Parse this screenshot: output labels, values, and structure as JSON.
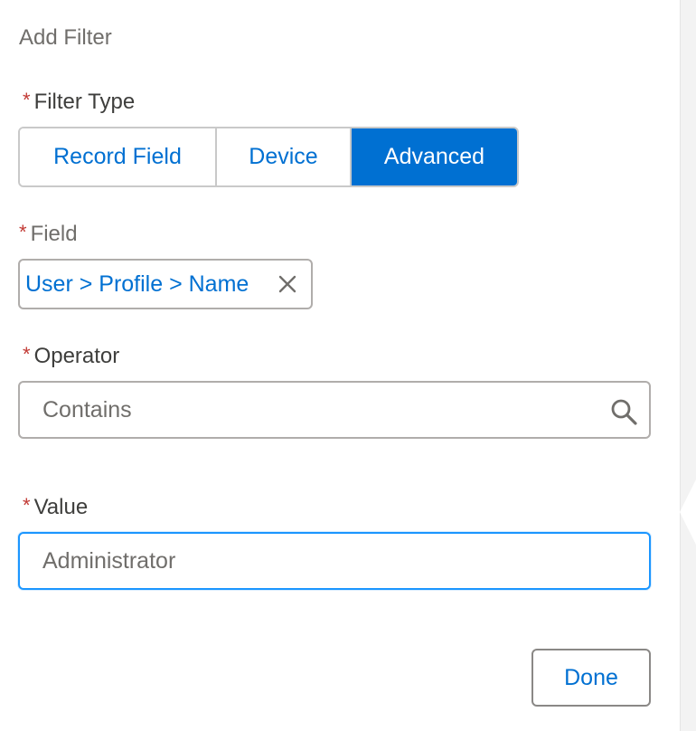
{
  "panel": {
    "title": "Add Filter"
  },
  "required_marker": "*",
  "filter_type": {
    "label": "Filter Type",
    "options": [
      "Record Field",
      "Device",
      "Advanced"
    ],
    "selected": "Advanced"
  },
  "field": {
    "label": "Field",
    "selected_pill": "User > Profile > Name"
  },
  "operator": {
    "label": "Operator",
    "value": "Contains"
  },
  "value": {
    "label": "Value",
    "value": "Administrator"
  },
  "footer": {
    "done_label": "Done"
  },
  "colors": {
    "brand": "#0070d2",
    "required": "#c23934",
    "focus": "#1b96ff"
  },
  "icons": {
    "remove": "close-icon",
    "search": "search-icon"
  }
}
